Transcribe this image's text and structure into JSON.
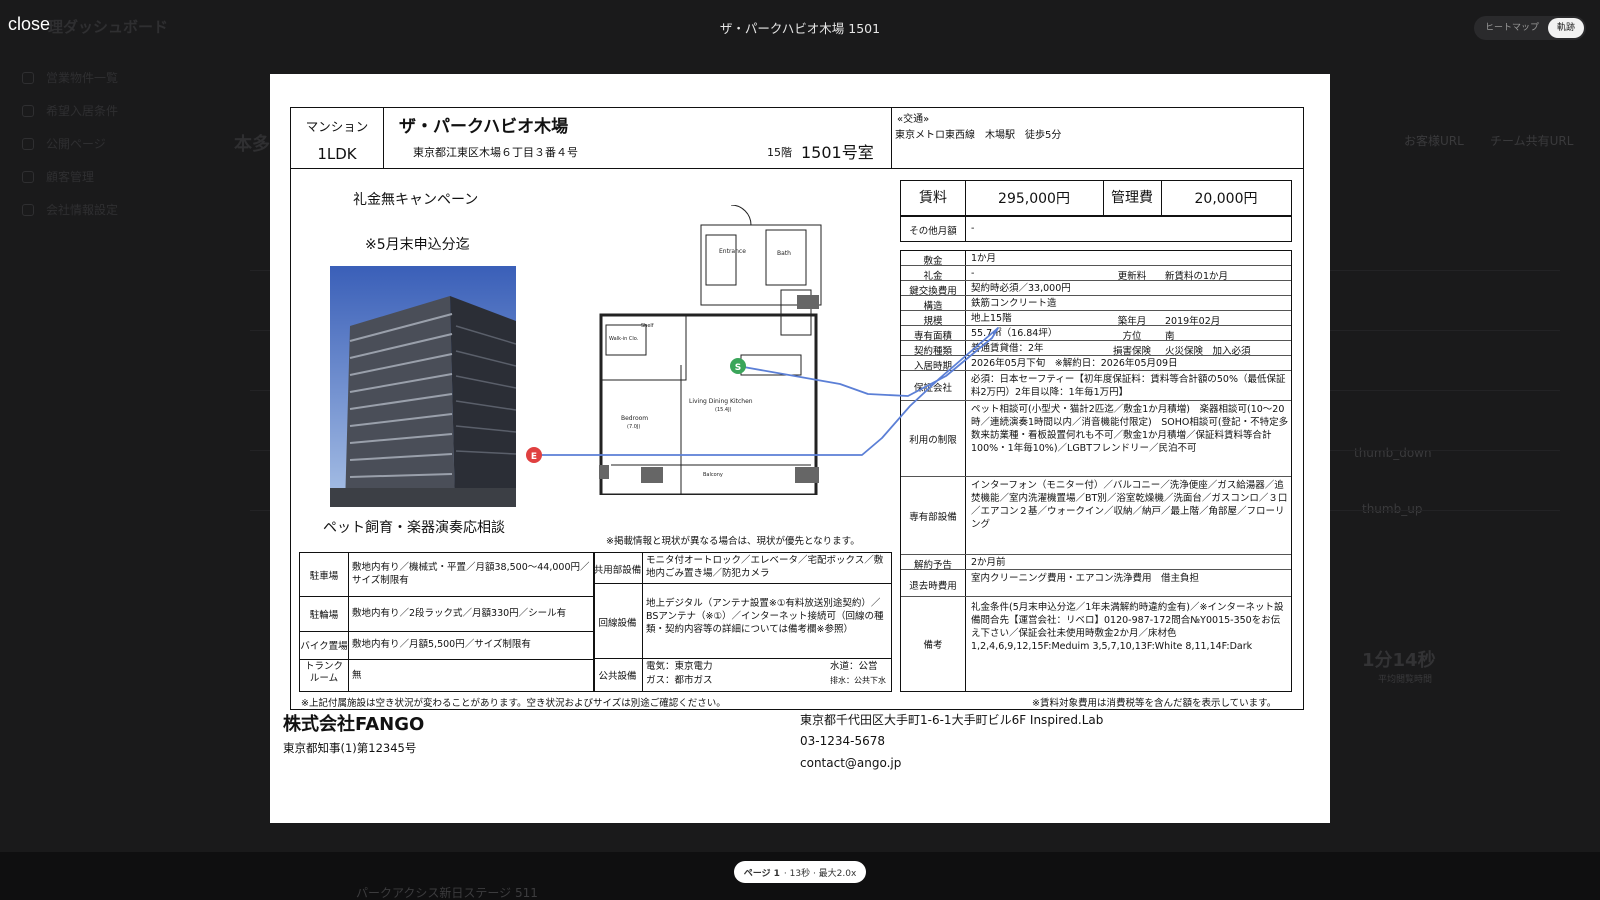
{
  "viewer": {
    "close_label": "close",
    "title": "ザ・パークハビオ木場 1501",
    "toggle": [
      "ヒートマップ",
      "軌跡"
    ],
    "page_label": "ページ 1",
    "page_meta": "· 13秒 · 最大2.0x"
  },
  "background": {
    "header": "理ダッシュボード",
    "sidebar": [
      "営業物件一覧",
      "希望入居条件",
      "公開ページ",
      "顧客管理",
      "会社情報設定"
    ],
    "title": "本多",
    "links": [
      "お客様URL",
      "チーム共有URL"
    ],
    "stat_value": "1分14秒",
    "stat_label": "平均閲覧時間",
    "thumb_down": "thumb_down",
    "thumb_up": "thumb_up",
    "bottom_item": "パークアクシス新日ステージ 511"
  },
  "doc": {
    "type": "マンション",
    "layout": "1LDK",
    "name": "ザ・パークハビオ木場",
    "address": "東京都江東区木場６丁目３番４号",
    "floor": "15階",
    "room": "1501号室",
    "transport_label": "«交通»",
    "transport": "東京メトロ東西線　木場駅　徒歩5分",
    "campaign1": "礼金無キャンペーン",
    "campaign2": "※5月末申込分迄",
    "pet_note": "ペット飼育・楽器演奏応相談",
    "disclaimer": "※掲載情報と現状が異なる場合は、現状が優先となります。",
    "rent_label": "賃料",
    "rent": "295,000円",
    "fee_label": "管理費",
    "fee": "20,000円",
    "other_label": "その他月額",
    "other": "-",
    "specs": {
      "deposit_l": "敷金",
      "deposit": "1か月",
      "key_l": "礼金",
      "key": "-",
      "renew_l": "更新料",
      "renew": "新賃料の1か月",
      "keyx_l": "鍵交換費用",
      "keyx": "契約時必須／33,000円",
      "struct_l": "構造",
      "struct": "鉄筋コンクリート造",
      "scale_l": "規模",
      "scale": "地上15階",
      "built_l": "築年月",
      "built": "2019年02月",
      "area_l": "専有面積",
      "area": "55.7㎡（16.84坪）",
      "dir_l": "方位",
      "dir": "南",
      "ctype_l": "契約種類",
      "ctype": "普通賃貸借：2年",
      "ins_l": "損害保険",
      "ins": "火災保険　加入必須",
      "movein_l": "入居時期",
      "movein": "2026年05月下旬　※解約日：2026年05月09日",
      "guar_l": "保証会社",
      "guar": "必須：日本セーフティー【初年度保証料：賃料等合計額の50%（最低保証料2万円）2年目以降：1年毎1万円】",
      "use_l": "利用の制限",
      "use": "ペット相談可(小型犬・猫計2匹迄／敷金1か月積増)　楽器相談可(10～20時／連続演奏1時間以内／消音機能付限定)　SOHO相談可(登記・不特定多数来訪業種・看板設置何れも不可／敷金1か月積増／保証料賃料等合計100%・1年毎10%)／LGBTフレンドリー／民泊不可",
      "equip_l": "専有部設備",
      "equip": "インターフォン（モニター付）／バルコニー／洗浄便座／ガス給湯器／追焚機能／室内洗濯機置場／BT別／浴室乾燥機／洗面台／ガスコンロ／３口／エアコン２基／ウォークイン／収納／納戸／最上階／角部屋／フローリング",
      "notice_l": "解約予告",
      "notice": "2か月前",
      "exit_l": "退去時費用",
      "exit": "室内クリーニング費用・エアコン洗浄費用　借主負担",
      "remarks_l": "備考",
      "remarks": "礼金条件(5月末申込分迄／1年未満解約時違約金有)／※インターネット設備問合先【運営会社：リベロ】0120-987-172問合№Y0015-350をお伝え下さい／保証会社未使用時敷金2か月／床材色1,2,4,6,9,12,15F:Meduim 3,5,7,10,13F:White 8,11,14F:Dark"
    },
    "facilities": {
      "parking_l": "駐車場",
      "parking": "敷地内有り／機械式・平置／月額38,500～44,000円／サイズ制限有",
      "bike_l": "駐輪場",
      "bike": "敷地内有り／2段ラック式／月額330円／シール有",
      "moto_l": "バイク置場",
      "moto": "敷地内有り／月額5,500円／サイズ制限有",
      "trunk_l": "トランクルーム",
      "trunk": "無",
      "shared_l": "共用部設備",
      "shared": "モニタ付オートロック／エレベータ／宅配ボックス／敷地内ごみ置き場／防犯カメラ",
      "net_l": "回線設備",
      "net": "地上デジタル（アンテナ設置※①有料放送別途契約）／BSアンテナ（※①）／インターネット接続可（回線の種類・契約内容等の詳細については備考欄※参照）",
      "util_l": "公共設備",
      "util_elec": "電気：東京電力",
      "util_gas": "ガス：都市ガス",
      "util_water": "水道：公営",
      "util_drain": "排水：公共下水"
    },
    "footnote_left": "※上記付属施設は空き状況が変わることがあります。空き状況およびサイズは別途ご確認ください。",
    "footnote_right": "※賃料対象費用は消費税等を含んだ額を表示しています。",
    "floorplan": {
      "ldk": "Living Dining Kitchen",
      "ldk_size": "(15.4J)",
      "bed": "Bedroom",
      "bed_size": "(7.0J)",
      "balcony": "Balcony",
      "entrance": "Entrance",
      "bath": "Bath",
      "wic": "Walk-in Clo.",
      "shelf": "Shelf",
      "start": "S",
      "end": "E"
    }
  },
  "company": {
    "name": "株式会社FANGO",
    "license": "東京都知事(1)第12345号",
    "address": "東京都千代田区大手町1-6-1大手町ビル6F Inspired.Lab",
    "phone": "03-1234-5678",
    "email": "contact@ango.jp"
  }
}
